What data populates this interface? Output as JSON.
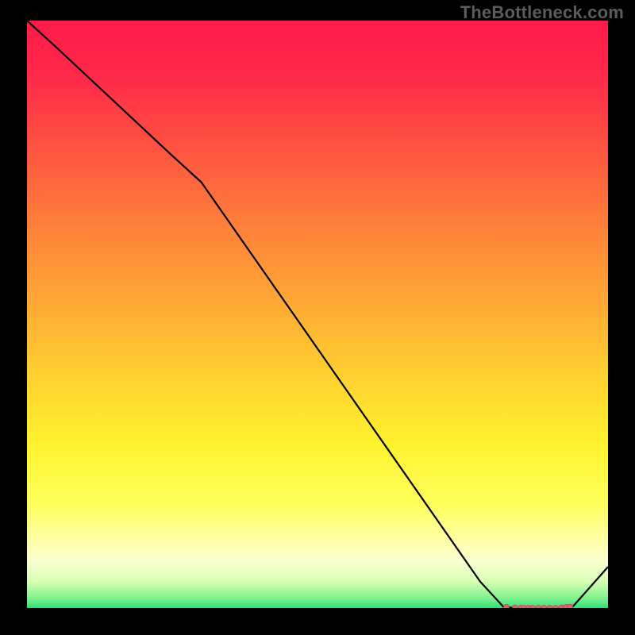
{
  "watermark": "TheBottleneck.com",
  "chart_data": {
    "type": "line",
    "title": "",
    "xlabel": "",
    "ylabel": "",
    "xlim": [
      0,
      100
    ],
    "ylim": [
      0,
      100
    ],
    "grid": false,
    "x": [
      0,
      5,
      25,
      30,
      78,
      82,
      84,
      86,
      88,
      90,
      92,
      94,
      100
    ],
    "y": [
      100,
      95.5,
      77,
      72.5,
      4.5,
      0.2,
      0.0,
      0.0,
      0.0,
      0.0,
      0.0,
      0.3,
      7
    ],
    "marker_x": [
      82.5,
      84,
      85,
      85.5,
      86.3,
      87,
      88,
      89,
      90,
      91,
      92,
      92.8,
      93.5
    ],
    "marker_y": [
      0.15,
      0.05,
      0.0,
      0.0,
      0.0,
      0.0,
      0.0,
      0.0,
      0.0,
      0.0,
      0.05,
      0.12,
      0.2
    ]
  },
  "gradient_stops": [
    {
      "offset": 0.0,
      "color": "#ff1a4a"
    },
    {
      "offset": 0.1,
      "color": "#ff2a49"
    },
    {
      "offset": 0.22,
      "color": "#ff5440"
    },
    {
      "offset": 0.35,
      "color": "#ff803a"
    },
    {
      "offset": 0.48,
      "color": "#ffa835"
    },
    {
      "offset": 0.6,
      "color": "#ffcf30"
    },
    {
      "offset": 0.72,
      "color": "#fff22e"
    },
    {
      "offset": 0.82,
      "color": "#ffff5a"
    },
    {
      "offset": 0.88,
      "color": "#ffffa0"
    },
    {
      "offset": 0.92,
      "color": "#faffd0"
    },
    {
      "offset": 0.955,
      "color": "#d8ffb4"
    },
    {
      "offset": 0.985,
      "color": "#7cf08a"
    },
    {
      "offset": 1.0,
      "color": "#2fe07a"
    }
  ],
  "colors": {
    "line": "#000000",
    "marker_fill": "#d46a6a",
    "marker_stroke": "#b84848"
  }
}
